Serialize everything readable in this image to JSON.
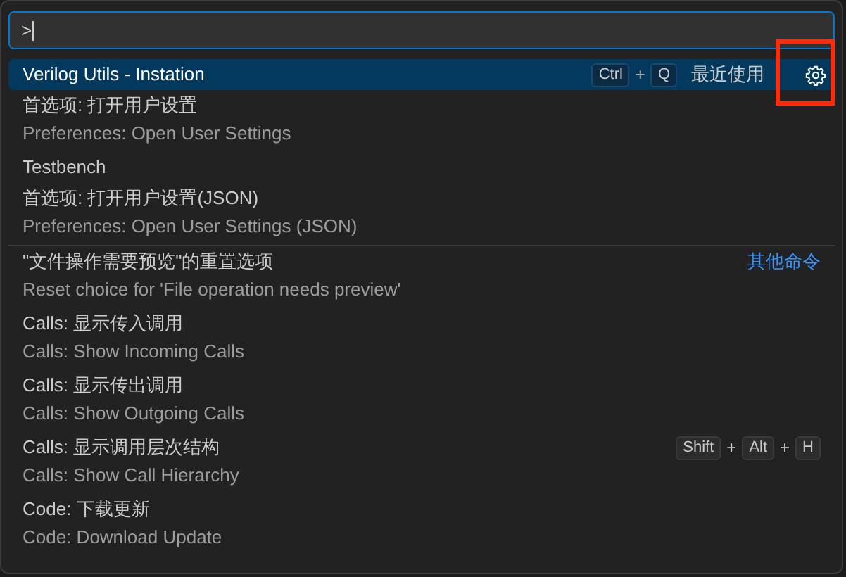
{
  "command_input": {
    "value": ">"
  },
  "items": [
    {
      "label": "Verilog Utils - Instation",
      "selected": true,
      "keys": [
        "Ctrl",
        "Q"
      ],
      "group_label": "最近使用"
    },
    {
      "label": "首选项: 打开用户设置",
      "detail": "Preferences: Open User Settings",
      "selected": false
    },
    {
      "label": "Testbench",
      "selected": false
    },
    {
      "label": "首选项: 打开用户设置(JSON)",
      "detail": "Preferences: Open User Settings (JSON)",
      "selected": false
    },
    {
      "label": "\"文件操作需要预览\"的重置选项",
      "detail": "Reset choice for 'File operation needs preview'",
      "selected": false,
      "separator_above": true,
      "group_label": "其他命令"
    },
    {
      "label": "Calls: 显示传入调用",
      "detail": "Calls: Show Incoming Calls",
      "selected": false
    },
    {
      "label": "Calls: 显示传出调用",
      "detail": "Calls: Show Outgoing Calls",
      "selected": false
    },
    {
      "label": "Calls: 显示调用层次结构",
      "detail": "Calls: Show Call Hierarchy",
      "selected": false,
      "keys": [
        "Shift",
        "Alt",
        "H"
      ]
    },
    {
      "label": "Code: 下载更新",
      "detail": "Code: Download Update",
      "selected": false
    }
  ],
  "key_separator": "+"
}
